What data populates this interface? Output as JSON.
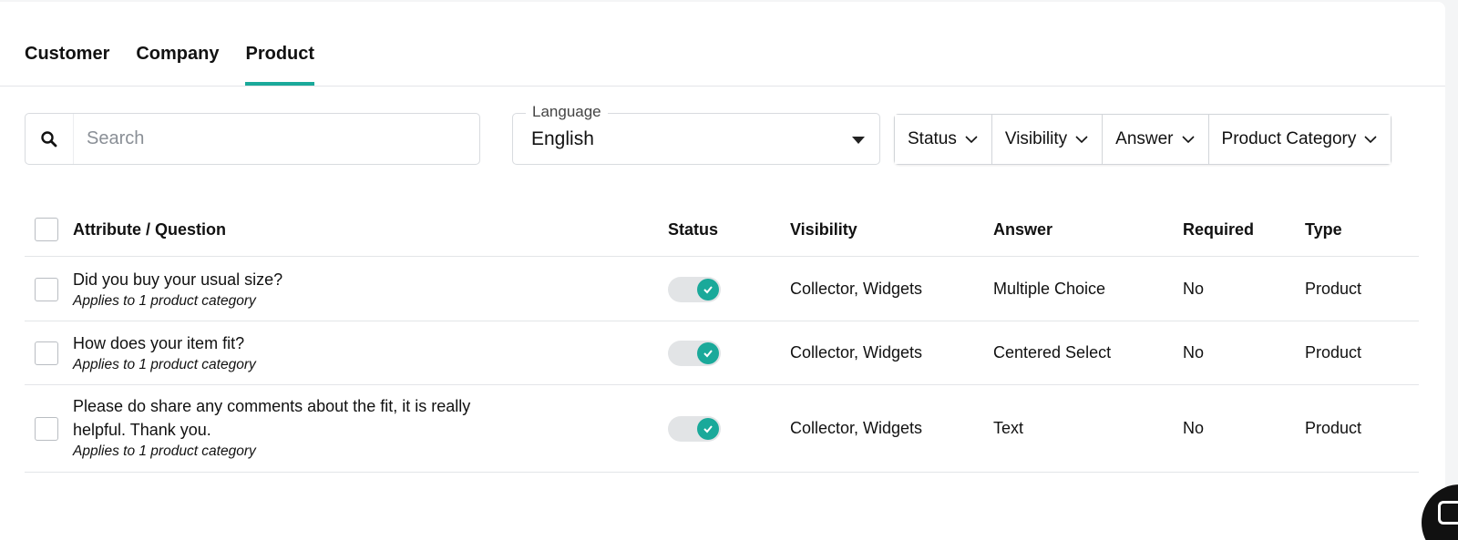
{
  "tabs": [
    {
      "label": "Customer",
      "active": false
    },
    {
      "label": "Company",
      "active": false
    },
    {
      "label": "Product",
      "active": true
    }
  ],
  "search": {
    "placeholder": "Search",
    "value": ""
  },
  "language": {
    "label": "Language",
    "value": "English"
  },
  "filters": {
    "status": "Status",
    "visibility": "Visibility",
    "answer": "Answer",
    "product_category": "Product Category"
  },
  "table": {
    "headers": {
      "attribute": "Attribute / Question",
      "status": "Status",
      "visibility": "Visibility",
      "answer": "Answer",
      "required": "Required",
      "type": "Type"
    },
    "rows": [
      {
        "question": "Did you buy your usual size?",
        "subtitle": "Applies to 1 product category",
        "status_on": true,
        "visibility": "Collector, Widgets",
        "answer": "Multiple Choice",
        "required": "No",
        "type": "Product"
      },
      {
        "question": "How does your item fit?",
        "subtitle": "Applies to 1 product category",
        "status_on": true,
        "visibility": "Collector, Widgets",
        "answer": "Centered Select",
        "required": "No",
        "type": "Product"
      },
      {
        "question": "Please do share any comments about the fit, it is really helpful. Thank you.",
        "subtitle": "Applies to 1 product category",
        "status_on": true,
        "visibility": "Collector, Widgets",
        "answer": "Text",
        "required": "No",
        "type": "Product"
      }
    ]
  },
  "colors": {
    "accent": "#1aa99a",
    "toggle_track": "#e2e4e6",
    "border": "#d8dbdf"
  },
  "icons": {
    "search": "search-icon",
    "chevron": "chevron-down-icon",
    "check": "check-icon",
    "chat": "chat-icon"
  }
}
